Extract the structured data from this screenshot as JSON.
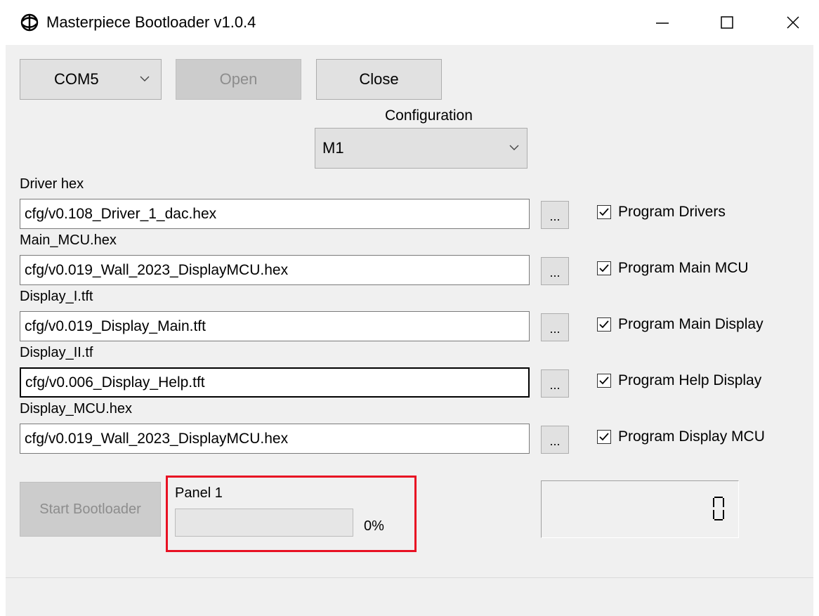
{
  "window": {
    "title": "Masterpiece Bootloader v1.0.4",
    "icon": "app-logo-icon",
    "controls": [
      "minimize-icon",
      "maximize-icon",
      "close-icon"
    ]
  },
  "toolbar": {
    "port_value": "COM5",
    "open_label": "Open",
    "close_label": "Close"
  },
  "configuration": {
    "label": "Configuration",
    "value": "M1"
  },
  "files": [
    {
      "label": "Driver hex",
      "value": "cfg/v0.108_Driver_1_dac.hex",
      "browse": "...",
      "check_label": "Program Drivers",
      "checked": true
    },
    {
      "label": "Main_MCU.hex",
      "value": "cfg/v0.019_Wall_2023_DisplayMCU.hex",
      "browse": "...",
      "check_label": "Program Main MCU",
      "checked": true
    },
    {
      "label": "Display_I.tft",
      "value": "cfg/v0.019_Display_Main.tft",
      "browse": "...",
      "check_label": "Program Main Display",
      "checked": true
    },
    {
      "label": "Display_II.tf",
      "value": "cfg/v0.006_Display_Help.tft",
      "browse": "...",
      "check_label": "Program Help Display",
      "checked": true
    },
    {
      "label": "Display_MCU.hex",
      "value": "cfg/v0.019_Wall_2023_DisplayMCU.hex",
      "browse": "...",
      "check_label": "Program Display MCU",
      "checked": true
    }
  ],
  "bootloader": {
    "start_label": "Start Bootloader",
    "panel_label": "Panel 1",
    "progress_text": "0%",
    "progress_fraction": 0
  },
  "counter": {
    "value": "0"
  },
  "colors": {
    "highlight_frame": "#e81123",
    "window_bg": "#f0f0f0",
    "button_bg": "#e1e1e1",
    "disabled_text": "#8d8d8d"
  }
}
